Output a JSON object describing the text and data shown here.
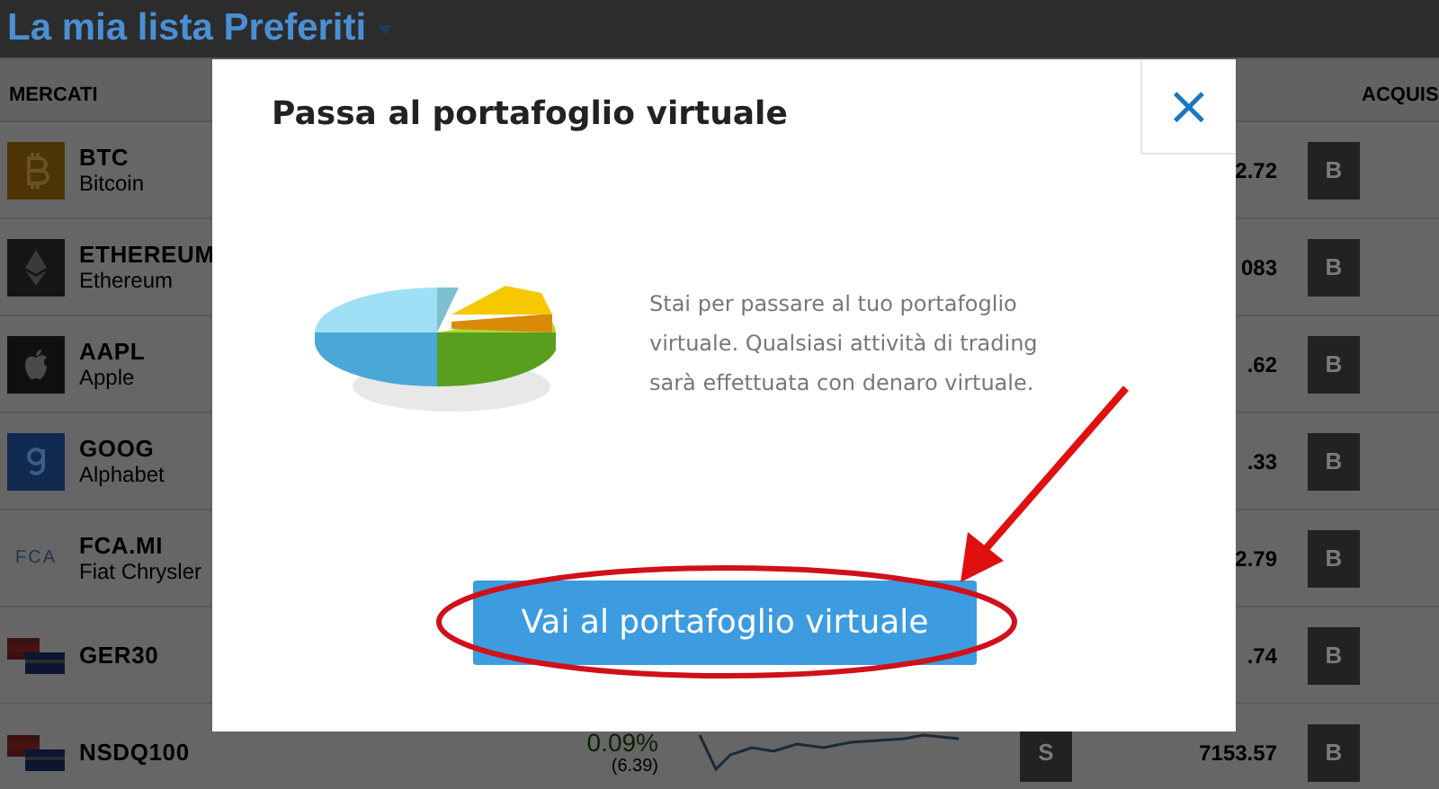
{
  "header": {
    "title": "La mia lista Preferiti"
  },
  "table": {
    "columns": {
      "market": "MERCATI",
      "buy": "ACQUIS"
    },
    "rows": [
      {
        "kind": "bitcoin",
        "ticker": "BTC",
        "name": "Bitcoin",
        "price": "2.72",
        "buy": "B"
      },
      {
        "kind": "ethereum",
        "ticker": "ETHEREUM",
        "name": "Ethereum",
        "price": "083",
        "buy": "B"
      },
      {
        "kind": "apple",
        "ticker": "AAPL",
        "name": "Apple",
        "price": ".62",
        "buy": "B"
      },
      {
        "kind": "google",
        "ticker": "GOOG",
        "name": "Alphabet",
        "price": ".33",
        "buy": "B"
      },
      {
        "kind": "fca",
        "logo_text": "FCA",
        "ticker": "FCA.MI",
        "name": "Fiat Chrysler",
        "price": "2.79",
        "buy": "B"
      },
      {
        "kind": "flag",
        "ticker": "GER30",
        "price": ".74",
        "buy": "B"
      },
      {
        "kind": "flag",
        "ticker": "NSDQ100",
        "change": "0.09%",
        "change_abs": "(6.39)",
        "sparkline": true,
        "sell": "S",
        "price": "7153.57",
        "buy": "B"
      }
    ]
  },
  "modal": {
    "title": "Passa al portafoglio virtuale",
    "close": "×",
    "text": "Stai per passare al tuo portafoglio virtuale. Qualsiasi attività di trading sarà effettuata con denaro virtuale.",
    "button": "Vai al portafoglio virtuale"
  }
}
